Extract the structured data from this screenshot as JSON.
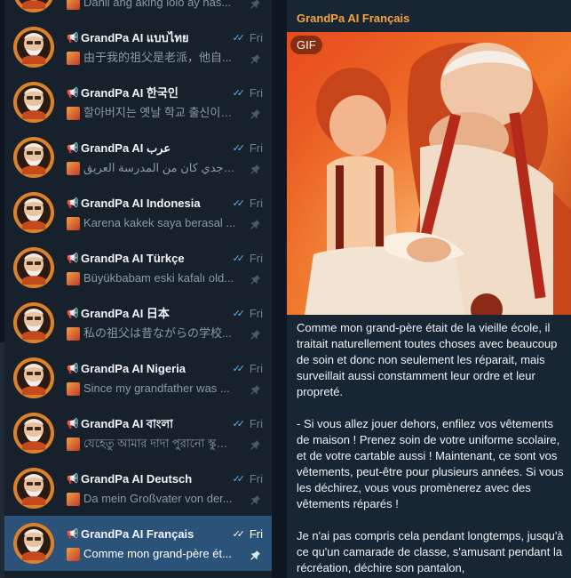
{
  "chats": [
    {
      "title": "",
      "time": "",
      "preview": "Dahil ang aking lolo ay nas..."
    },
    {
      "title": "GrandPa AI แบบไทย",
      "time": "Fri",
      "preview": "由于我的祖父是老派，他自..."
    },
    {
      "title": "GrandPa AI 한국인",
      "time": "Fri",
      "preview": "할아버지는 옛날 학교 출신이셨..."
    },
    {
      "title": "GrandPa AI عرب",
      "time": "Fri",
      "preview": "لأن جدي كان من المدرسة العريق..."
    },
    {
      "title": "GrandPa AI Indonesia",
      "time": "Fri",
      "preview": "Karena kakek saya berasal ..."
    },
    {
      "title": "GrandPa AI Türkçe",
      "time": "Fri",
      "preview": "Büyükbabam eski kafalı old..."
    },
    {
      "title": "GrandPa AI 日本",
      "time": "Fri",
      "preview": "私の祖父は昔ながらの学校..."
    },
    {
      "title": "GrandPa AI Nigeria",
      "time": "Fri",
      "preview": "Since my grandfather was ..."
    },
    {
      "title": "GrandPa AI বাংলা",
      "time": "Fri",
      "preview": "যেহেতু আমার দাদা পুরানো স্কুলের ..."
    },
    {
      "title": "GrandPa AI Deutsch",
      "time": "Fri",
      "preview": "Da mein Großvater von der..."
    },
    {
      "title": "GrandPa AI Français",
      "time": "Fri",
      "preview": "Comme mon grand-père ét..."
    }
  ],
  "active_chat_index": 10,
  "megaphone_icon": "📢",
  "read_icon": "double-check-icon",
  "main": {
    "channel_name": "GrandPa AI Français",
    "gif_label": "GIF",
    "paragraphs": [
      "Comme mon grand-père était de la vieille école, il traitait naturellement toutes choses avec beaucoup de soin et donc non seulement les réparait, mais surveillait aussi constamment leur ordre et leur propreté.",
      "- Si vous allez jouer dehors, enfilez vos vêtements de maison ! Prenez soin de votre uniforme scolaire, et de votre cartable aussi ! Maintenant, ce sont vos vêtements, peut-être pour plusieurs années. Si vous les déchirez, vous vous promènerez avec des vêtements réparés !",
      "Je n'ai pas compris cela pendant longtemps, jusqu'à ce qu'un camarade de classe, s'amusant pendant la récréation, déchire son pantalon,"
    ]
  },
  "colors": {
    "sidebar_bg": "#17212b",
    "active_bg": "#2b5278",
    "accent_title": "#f5a43b",
    "check_blue": "#5eb5f7"
  }
}
